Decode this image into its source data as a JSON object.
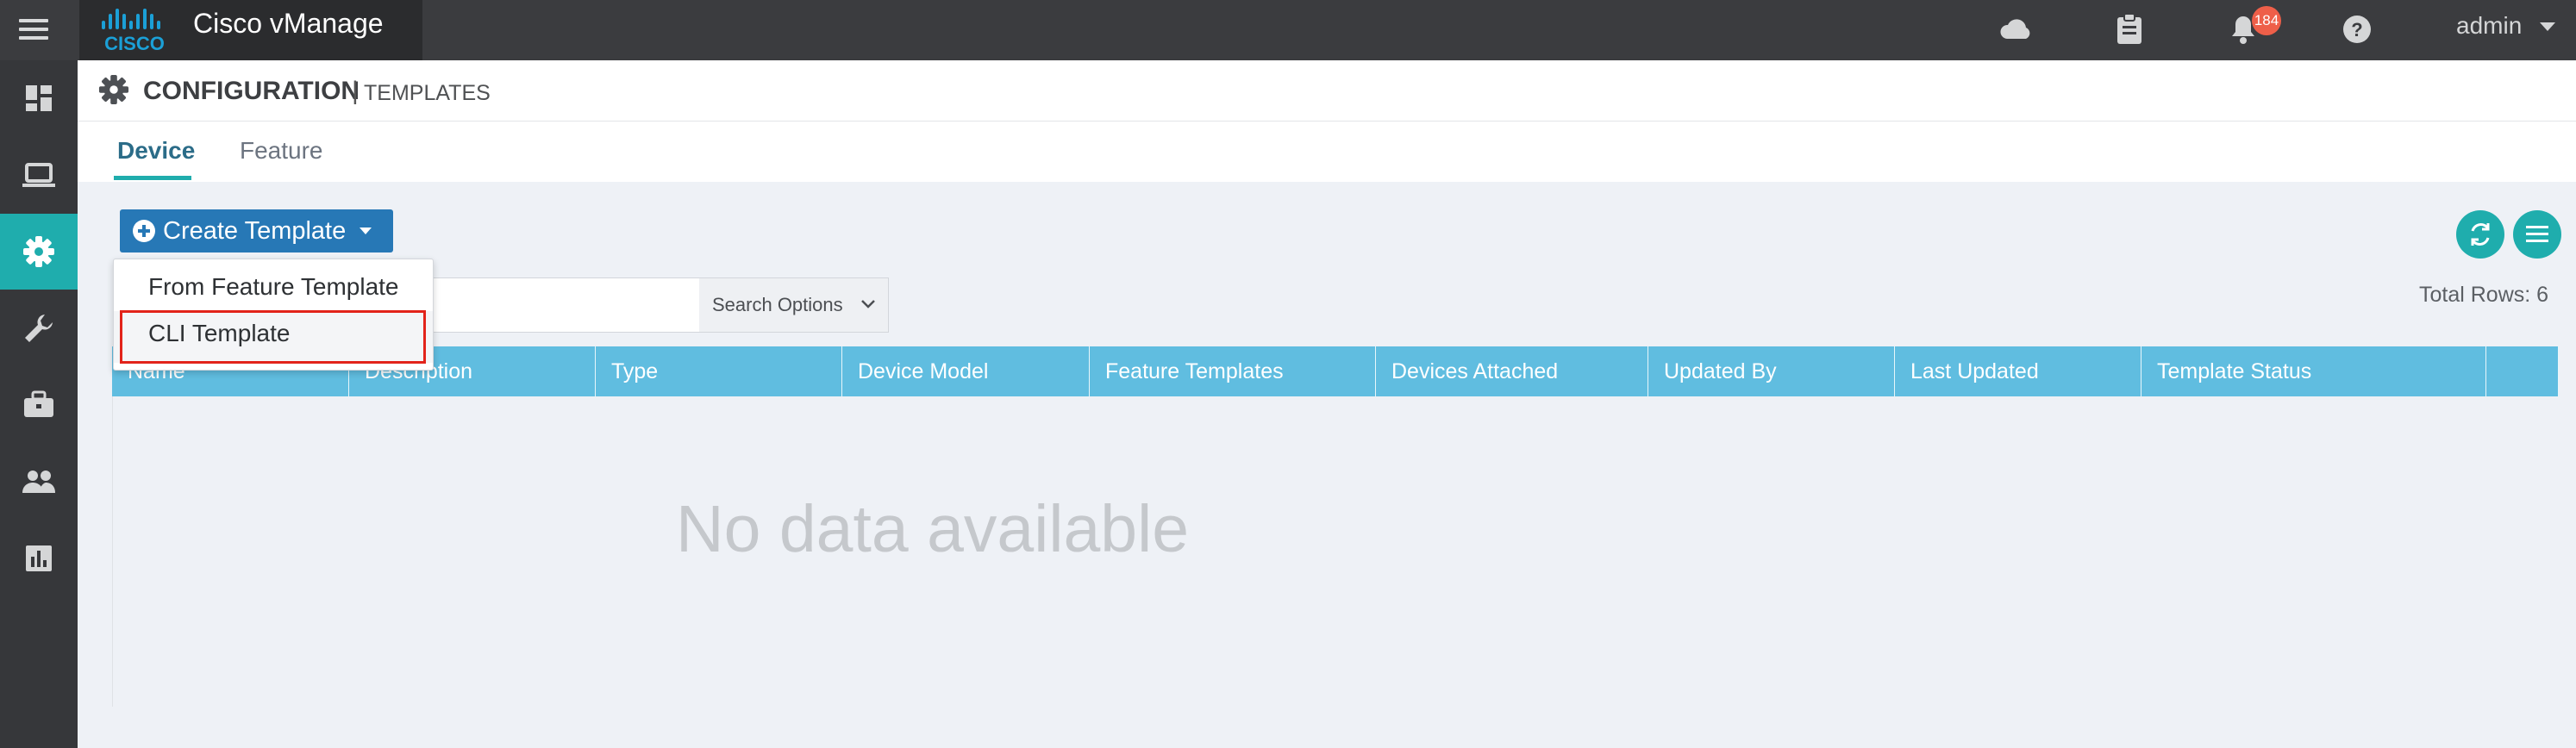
{
  "app": {
    "title": "Cisco vManage",
    "brand_color": "#2b2c2e",
    "accent_color": "#1fadad"
  },
  "topbar": {
    "icons": [
      "cloud-icon",
      "clipboard-icon",
      "bell-icon",
      "help-icon"
    ],
    "notification_count": "184",
    "user": "admin"
  },
  "sidebar": {
    "items": [
      {
        "name": "dashboard-icon",
        "active": false
      },
      {
        "name": "monitor-icon",
        "active": false
      },
      {
        "name": "configuration-gear-icon",
        "active": true
      },
      {
        "name": "tools-wrench-icon",
        "active": false
      },
      {
        "name": "maintenance-briefcase-icon",
        "active": false
      },
      {
        "name": "administration-users-icon",
        "active": false
      },
      {
        "name": "analytics-chart-icon",
        "active": false
      }
    ]
  },
  "header": {
    "section": "CONFIGURATION",
    "separator": "|",
    "subsection": "TEMPLATES"
  },
  "tabs": [
    {
      "label": "Device",
      "active": true
    },
    {
      "label": "Feature",
      "active": false
    }
  ],
  "toolbar": {
    "create_label": "Create Template",
    "search_placeholder": "",
    "search_options_label": "Search Options",
    "total_rows": "Total Rows: 6"
  },
  "dropdown": {
    "items": [
      "From Feature Template",
      "CLI Template"
    ],
    "highlighted": "CLI Template"
  },
  "table": {
    "columns": [
      "Name",
      "Description",
      "Type",
      "Device Model",
      "Feature Templates",
      "Devices Attached",
      "Updated By",
      "Last Updated",
      "Template Status"
    ],
    "rows": [],
    "empty_message": "No data available"
  }
}
